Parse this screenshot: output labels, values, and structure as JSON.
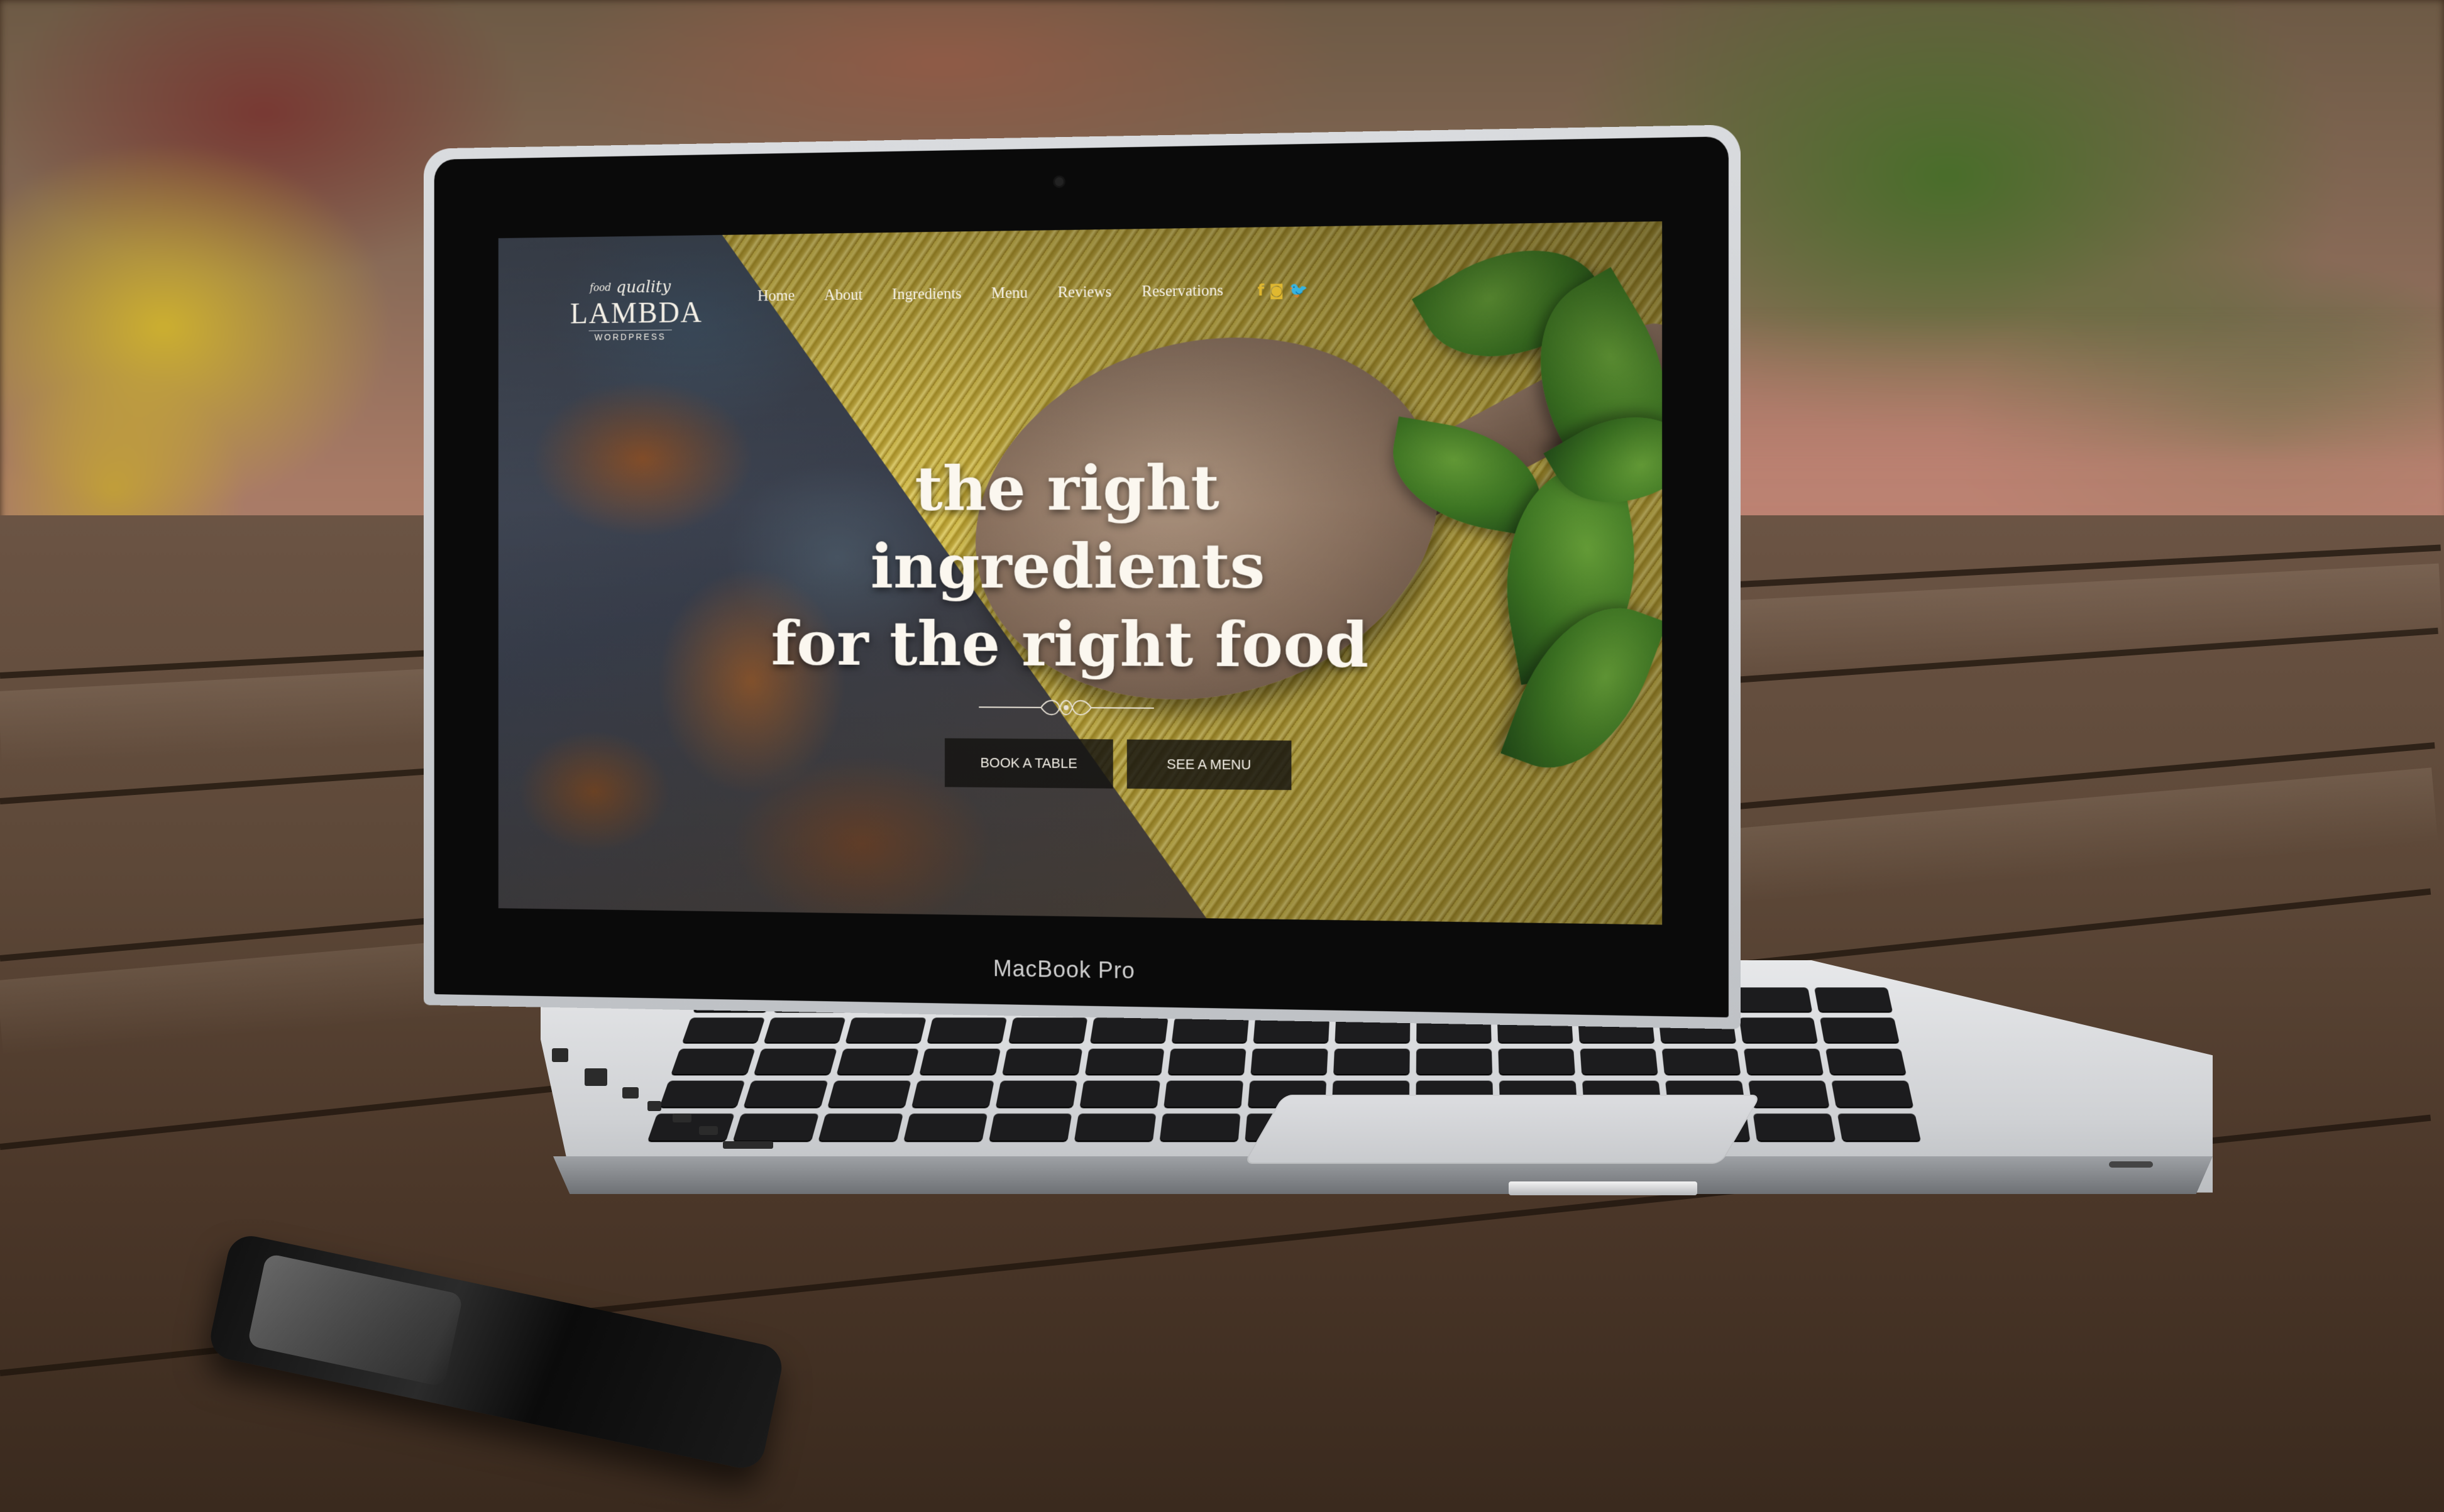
{
  "laptop": {
    "brand_label": "MacBook Pro"
  },
  "website": {
    "logo": {
      "tagline_top": "food",
      "tagline": "quality",
      "name": "LAMBDA",
      "subtitle": "WORDPRESS"
    },
    "nav": {
      "items": [
        {
          "label": "Home"
        },
        {
          "label": "About"
        },
        {
          "label": "Ingredients"
        },
        {
          "label": "Menu"
        },
        {
          "label": "Reviews"
        },
        {
          "label": "Reservations"
        }
      ],
      "social": {
        "facebook": "f",
        "instagram": "◙",
        "twitter": "🐦"
      }
    },
    "hero": {
      "line1": "the right ingredients",
      "line2": "for the right food",
      "buttons": {
        "book": "BOOK A TABLE",
        "menu": "SEE A MENU"
      }
    },
    "colors": {
      "accent": "#e0b830",
      "text_light": "#fbf7ef",
      "button_bg": "#141210"
    }
  }
}
